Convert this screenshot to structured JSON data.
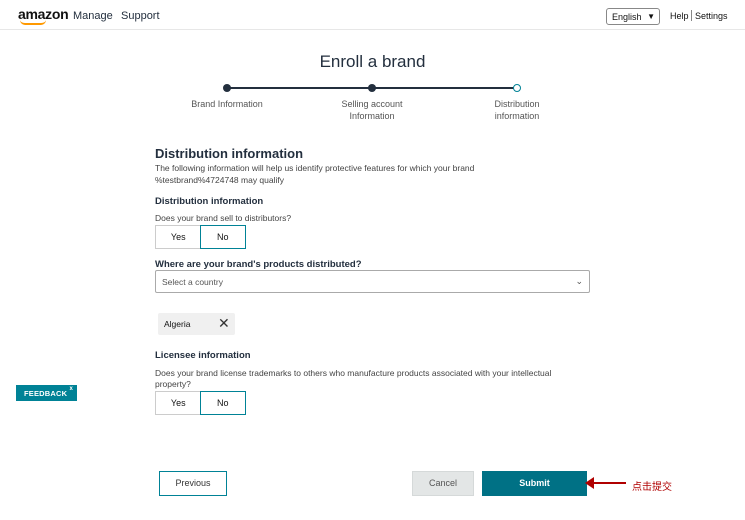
{
  "header": {
    "logo": "amazon",
    "nav": [
      "Manage",
      "Support"
    ],
    "language": "English",
    "help": "Help",
    "settings": "Settings"
  },
  "page": {
    "title": "Enroll a brand",
    "steps": [
      {
        "label": "Brand Information",
        "state": "complete"
      },
      {
        "label": "Selling account Information",
        "state": "complete"
      },
      {
        "label": "Distribution information",
        "state": "current"
      }
    ]
  },
  "form": {
    "section_title": "Distribution information",
    "description": "The following information will help us identify protective features for which your brand %testbrand%4724748 may qualify",
    "distribution": {
      "heading": "Distribution information",
      "question": "Does your brand sell to distributors?",
      "options": [
        "Yes",
        "No"
      ],
      "selected": "No"
    },
    "countries": {
      "label": "Where are your brand's products distributed?",
      "placeholder": "Select a country",
      "selected_chips": [
        "Algeria"
      ]
    },
    "licensee": {
      "heading": "Licensee information",
      "question": "Does your brand license trademarks to others who manufacture products associated with your intellectual property?",
      "options": [
        "Yes",
        "No"
      ],
      "selected": "No"
    }
  },
  "feedback": {
    "label": "FEEDBACK",
    "close": "x"
  },
  "actions": {
    "previous": "Previous",
    "cancel": "Cancel",
    "submit": "Submit"
  },
  "annotation": {
    "text": "点击提交"
  },
  "colors": {
    "accent": "#008296",
    "submit": "#007185",
    "annotation": "#b00000",
    "logo_smile": "#ff9900"
  }
}
